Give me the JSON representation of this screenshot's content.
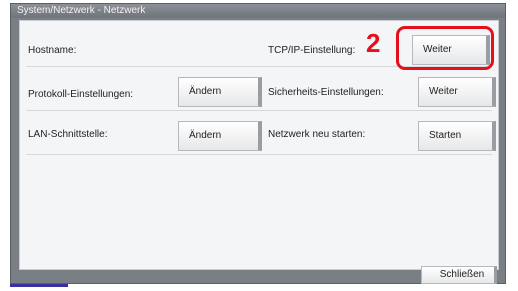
{
  "window": {
    "title": "System/Netzwerk - Netzwerk"
  },
  "settings": {
    "hostname_label": "Hostname:",
    "tcpip_label": "TCP/IP-Einstellung:",
    "tcpip_button": "Weiter",
    "protocol_label": "Protokoll-Einstellungen:",
    "protocol_button": "Ändern",
    "security_label": "Sicherheits-Einstellungen:",
    "security_button": "Weiter",
    "lan_label": "LAN-Schnittstelle:",
    "lan_button": "Ändern",
    "restart_label": "Netzwerk neu starten:",
    "restart_button": "Starten"
  },
  "annotation": {
    "step_number": "2",
    "highlight_color": "#e4101b"
  },
  "footer": {
    "close_button": "Schließen"
  }
}
